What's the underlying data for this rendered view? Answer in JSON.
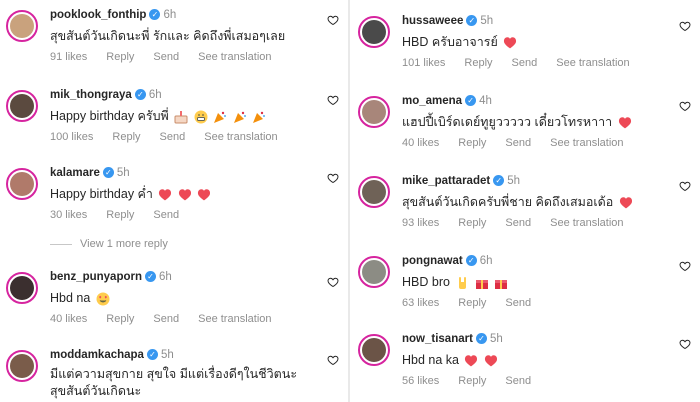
{
  "colors": {
    "heart_red": "#ed4956",
    "verified": "#3897f0",
    "muted": "#8e8e8e",
    "ring": "#d6249f"
  },
  "actions": {
    "reply": "Reply",
    "send": "Send",
    "see_translation": "See translation"
  },
  "view_more": "View 1 more reply",
  "left": [
    {
      "username": "pooklook_fonthip",
      "time": "6h",
      "text": "สุขสันต์วันเกิดนะพี่ รักและ คิดถึงพี่เสมอๆเลย",
      "likes": "91 likes",
      "avatar_color": "#c9a27d",
      "translate": true
    },
    {
      "username": "mik_thongraya",
      "time": "6h",
      "text": "Happy birthday ครับพี่",
      "emojis": [
        "cake",
        "grin",
        "party",
        "party",
        "party"
      ],
      "likes": "100 likes",
      "avatar_color": "#5b4a3f",
      "translate": true
    },
    {
      "username": "kalamare",
      "time": "5h",
      "text": "Happy birthday ค่ำ",
      "emojis": [
        "heart",
        "heart",
        "heart"
      ],
      "likes": "30 likes",
      "avatar_color": "#b07a6a",
      "translate": false
    },
    {
      "username": "benz_punyaporn",
      "time": "6h",
      "text": "Hbd na",
      "emojis": [
        "hearteyes"
      ],
      "likes": "40 likes",
      "avatar_color": "#3b2f2f",
      "translate": true
    },
    {
      "username": "moddamkachapa",
      "time": "5h",
      "text": "มีแต่ความสุขกาย สุขใจ มีแต่เรื่องดีๆในชีวิตนะ",
      "text2": "สุขสันต์วันเกิดนะ",
      "avatar_color": "#7a5c4a"
    }
  ],
  "right": [
    {
      "username": "hussaweee",
      "time": "5h",
      "text": "HBD ครับอาจารย์",
      "emojis": [
        "heart"
      ],
      "likes": "101 likes",
      "avatar_color": "#4a4a4a",
      "translate": true
    },
    {
      "username": "mo_amena",
      "time": "4h",
      "text": "แฮปปี้เบิร์ดเดย์ทูยูววววว เดี๋ยวโทรหาาา",
      "emojis": [
        "heart"
      ],
      "likes": "40 likes",
      "avatar_color": "#a8867a",
      "translate": true
    },
    {
      "username": "mike_pattaradet",
      "time": "5h",
      "text": "สุขสันต์วันเกิดครับพี่ชาย คิดถึงเสมอเด้อ",
      "emojis": [
        "heart"
      ],
      "likes": "93 likes",
      "avatar_color": "#6f6257",
      "translate": true
    },
    {
      "username": "pongnawat",
      "time": "6h",
      "text": "HBD bro",
      "emojis": [
        "rock",
        "gift",
        "gift"
      ],
      "likes": "63 likes",
      "avatar_color": "#8c8c84",
      "translate": false
    },
    {
      "username": "now_tisanart",
      "time": "5h",
      "text": "Hbd na ka",
      "emojis": [
        "heart",
        "heart"
      ],
      "likes": "56 likes",
      "avatar_color": "#6b5447",
      "translate": false
    }
  ]
}
